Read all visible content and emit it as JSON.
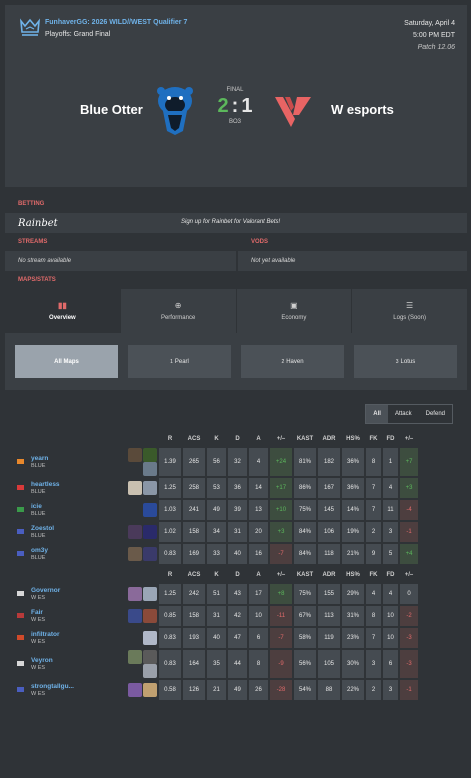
{
  "event": {
    "title": "FunhaverGG: 2026 WILD//WEST Qualifier 7",
    "stage": "Playoffs: Grand Final",
    "date": "Saturday, April 4",
    "time": "5:00 PM EDT",
    "patch": "Patch 12.06"
  },
  "match": {
    "status": "FINAL",
    "score_left": "2",
    "score_sep": ":",
    "score_right": "1",
    "format": "BO3",
    "team_left": "Blue Otter",
    "team_right": "W esports"
  },
  "betting": {
    "label": "BETTING",
    "brand": "Rainbet",
    "cta": "Sign up for Rainbet for Valorant Bets!"
  },
  "streams": {
    "label": "STREAMS",
    "text": "No stream available"
  },
  "vods": {
    "label": "VODS",
    "text": "Not yet available"
  },
  "maps_stats_label": "MAPS/STATS",
  "tabs": [
    {
      "label": "Overview",
      "icon": "bar-chart-icon"
    },
    {
      "label": "Performance",
      "icon": "crosshair-icon"
    },
    {
      "label": "Economy",
      "icon": "money-icon"
    },
    {
      "label": "Logs (Soon)",
      "icon": "list-icon"
    }
  ],
  "maps": [
    {
      "num": "",
      "label": "All Maps"
    },
    {
      "num": "1",
      "label": "Pearl"
    },
    {
      "num": "2",
      "label": "Haven"
    },
    {
      "num": "3",
      "label": "Lotus"
    }
  ],
  "filters": [
    "All",
    "Attack",
    "Defend"
  ],
  "columns": [
    "R",
    "ACS",
    "K",
    "D",
    "A",
    "+/–",
    "KAST",
    "ADR",
    "HS%",
    "FK",
    "FD",
    "+/–"
  ],
  "team_left_players": [
    {
      "name": "yearn",
      "team": "BLUE",
      "r": "1.39",
      "acs": "265",
      "k": "56",
      "d": "32",
      "a": "4",
      "pm": "+24",
      "kast": "81%",
      "adr": "182",
      "hs": "36%",
      "fk": "8",
      "fd": "1",
      "fpm": "+7"
    },
    {
      "name": "heartless",
      "team": "BLUE",
      "r": "1.25",
      "acs": "258",
      "k": "53",
      "d": "36",
      "a": "14",
      "pm": "+17",
      "kast": "86%",
      "adr": "167",
      "hs": "36%",
      "fk": "7",
      "fd": "4",
      "fpm": "+3"
    },
    {
      "name": "icie",
      "team": "BLUE",
      "r": "1.03",
      "acs": "241",
      "k": "49",
      "d": "39",
      "a": "13",
      "pm": "+10",
      "kast": "75%",
      "adr": "145",
      "hs": "14%",
      "fk": "7",
      "fd": "11",
      "fpm": "-4"
    },
    {
      "name": "Zoestol",
      "team": "BLUE",
      "r": "1.02",
      "acs": "158",
      "k": "34",
      "d": "31",
      "a": "20",
      "pm": "+3",
      "kast": "84%",
      "adr": "106",
      "hs": "19%",
      "fk": "2",
      "fd": "3",
      "fpm": "-1"
    },
    {
      "name": "om3y",
      "team": "BLUE",
      "r": "0.83",
      "acs": "169",
      "k": "33",
      "d": "40",
      "a": "16",
      "pm": "-7",
      "kast": "84%",
      "adr": "118",
      "hs": "21%",
      "fk": "9",
      "fd": "5",
      "fpm": "+4"
    }
  ],
  "team_right_players": [
    {
      "name": "Governor",
      "team": "W ES",
      "r": "1.25",
      "acs": "242",
      "k": "51",
      "d": "43",
      "a": "17",
      "pm": "+8",
      "kast": "75%",
      "adr": "155",
      "hs": "29%",
      "fk": "4",
      "fd": "4",
      "fpm": "0"
    },
    {
      "name": "Fair",
      "team": "W ES",
      "r": "0.85",
      "acs": "158",
      "k": "31",
      "d": "42",
      "a": "10",
      "pm": "-11",
      "kast": "67%",
      "adr": "113",
      "hs": "31%",
      "fk": "8",
      "fd": "10",
      "fpm": "-2"
    },
    {
      "name": "infiltrator",
      "team": "W ES",
      "r": "0.83",
      "acs": "193",
      "k": "40",
      "d": "47",
      "a": "6",
      "pm": "-7",
      "kast": "58%",
      "adr": "119",
      "hs": "23%",
      "fk": "7",
      "fd": "10",
      "fpm": "-3"
    },
    {
      "name": "Veyron",
      "team": "W ES",
      "r": "0.83",
      "acs": "164",
      "k": "35",
      "d": "44",
      "a": "8",
      "pm": "-9",
      "kast": "56%",
      "adr": "105",
      "hs": "30%",
      "fk": "3",
      "fd": "6",
      "fpm": "-3"
    },
    {
      "name": "strongtallgu...",
      "team": "W ES",
      "r": "0.58",
      "acs": "126",
      "k": "21",
      "d": "49",
      "a": "26",
      "pm": "-28",
      "kast": "54%",
      "adr": "88",
      "hs": "22%",
      "fk": "2",
      "fd": "3",
      "fpm": "-1"
    }
  ],
  "colors": {
    "accent_blue": "#6fb2e8",
    "accent_red": "#e06a6a",
    "win_green": "#5cb85c"
  }
}
